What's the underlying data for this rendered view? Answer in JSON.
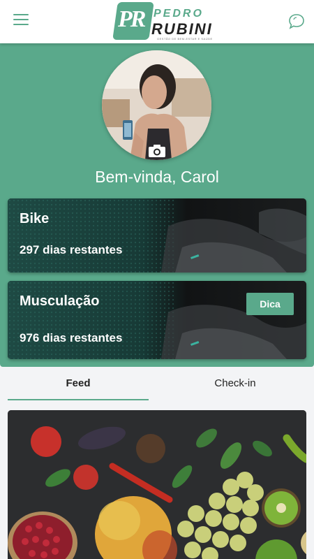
{
  "header": {
    "logo_mark": "PR",
    "logo_name_first": "PEDRO",
    "logo_name_last": "RUBINI",
    "logo_tagline": "GESTÃO DE BEM-ESTAR E SAÚDE",
    "menu_icon": "hamburger-menu-icon",
    "chat_icon": "chat-bubble-icon"
  },
  "profile": {
    "greeting": "Bem-vinda, Carol",
    "photo": "profile-photo",
    "camera_icon": "camera-icon"
  },
  "plans": [
    {
      "title": "Bike",
      "days": "297 dias restantes"
    },
    {
      "title": "Musculação",
      "days": "976 dias restantes",
      "action": "Dica"
    }
  ],
  "tabs": [
    {
      "label": "Feed",
      "active": true
    },
    {
      "label": "Check-in",
      "active": false
    }
  ],
  "feed": {
    "image": "fruits-vegetables-photo"
  },
  "colors": {
    "accent": "#5aa98b",
    "background": "#f3f4f6",
    "card_dark": "#1a1c1d"
  }
}
